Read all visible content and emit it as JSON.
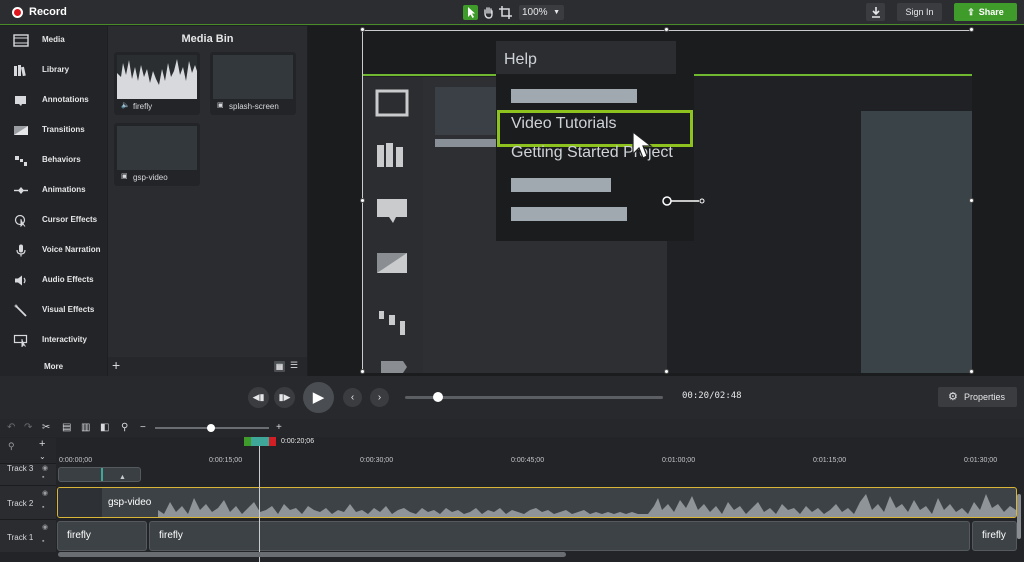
{
  "topbar": {
    "record_label": "Record",
    "zoom_value": "100%",
    "signin_label": "Sign In",
    "share_label": "Share",
    "accent_color": "#3f9b2a",
    "record_color": "#e0161f"
  },
  "tools": {
    "items": [
      {
        "label": "Media",
        "icon": "film-icon"
      },
      {
        "label": "Library",
        "icon": "library-icon"
      },
      {
        "label": "Annotations",
        "icon": "annotation-icon"
      },
      {
        "label": "Transitions",
        "icon": "transition-icon"
      },
      {
        "label": "Behaviors",
        "icon": "behaviors-icon"
      },
      {
        "label": "Animations",
        "icon": "animation-icon"
      },
      {
        "label": "Cursor Effects",
        "icon": "cursor-icon"
      },
      {
        "label": "Voice Narration",
        "icon": "microphone-icon"
      },
      {
        "label": "Audio Effects",
        "icon": "speaker-icon"
      },
      {
        "label": "Visual Effects",
        "icon": "wand-icon"
      },
      {
        "label": "Interactivity",
        "icon": "interactivity-icon"
      }
    ],
    "more_label": "More"
  },
  "mediabin": {
    "title": "Media Bin",
    "items": [
      {
        "label": "firefly",
        "icon": "audio-icon"
      },
      {
        "label": "splash-screen",
        "icon": "image-icon"
      },
      {
        "label": "gsp-video",
        "icon": "video-icon"
      }
    ]
  },
  "canvas": {
    "menu_title": "Help",
    "menu_items": [
      "Video Tutorials",
      "Getting Started Project"
    ],
    "highlight_color": "#8dc21f"
  },
  "controls": {
    "time": "00:20/02:48",
    "scrub_fraction": 0.12,
    "properties_label": "Properties"
  },
  "timeline": {
    "playhead_time": "0:00:20;06",
    "ruler_labels": [
      "0:00:00;00",
      "0:00:15;00",
      "0:00:30;00",
      "0:00:45;00",
      "0:01:00;00",
      "0:01:15;00",
      "0:01:30;00"
    ],
    "tracks": [
      {
        "name": "Track 3"
      },
      {
        "name": "Track 2",
        "clip": "gsp-video"
      },
      {
        "name": "Track 1",
        "clips": [
          "firefly",
          "firefly",
          "firefly"
        ]
      }
    ]
  }
}
